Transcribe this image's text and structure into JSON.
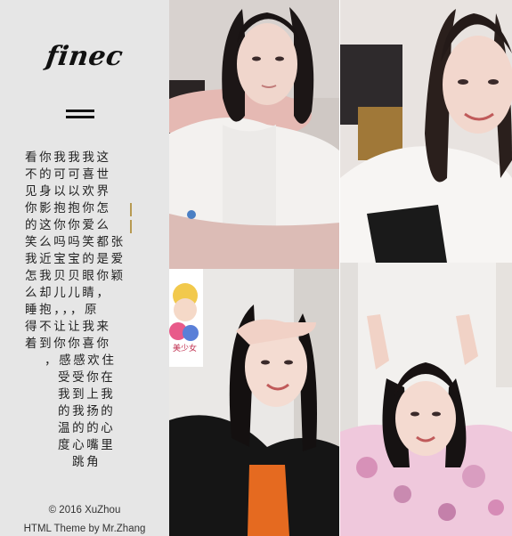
{
  "sidebar": {
    "logo_text": "finec",
    "menu_icon": "hamburger-icon",
    "poem_lines": [
      "看你我我我这",
      "不的可可喜世",
      "见身以以欢界",
      "你影抱抱你怎",
      "的这你你爱么",
      "笑么吗吗笑都张",
      "我近宝宝的是爱",
      "怎我贝贝眼你颖",
      "么却儿儿睛，",
      "睡抱，，，原",
      "得不让让我来",
      "着到你你喜你",
      "，感感欢住",
      "受受你在",
      "我到上我",
      "的我扬的",
      "温的的心",
      "度心嘴里",
      "跳角"
    ],
    "footer": {
      "copyright": "© 2016 XuZhou",
      "theme_credit": "HTML Theme by Mr.Zhang"
    }
  },
  "gallery": {
    "photos": [
      {
        "name": "photo-selfie-white-shirt"
      },
      {
        "name": "photo-selfie-smiling-white-tee"
      },
      {
        "name": "photo-selfie-black-jacket"
      },
      {
        "name": "photo-selfie-pink-floral"
      }
    ],
    "sticker_text": "美少女战士"
  },
  "colors": {
    "sidebar_bg": "#e6e6e6",
    "text": "#222222",
    "cursor_accent": "#b79a52"
  }
}
